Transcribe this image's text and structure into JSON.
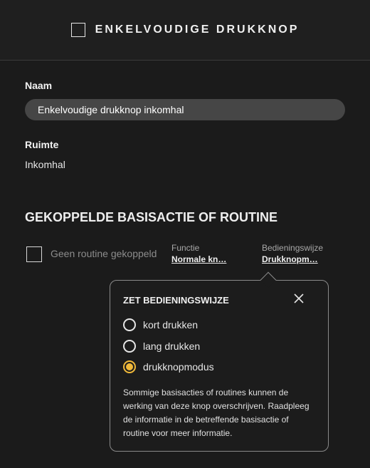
{
  "header": {
    "title": "ENKELVOUDIGE DRUKKNOP",
    "icon": "square-outline-icon"
  },
  "name": {
    "label": "Naam",
    "value": "Enkelvoudige drukknop inkomhal"
  },
  "room": {
    "label": "Ruimte",
    "value": "Inkomhal"
  },
  "linked": {
    "section_title": "GEKOPPELDE BASISACTIE OF ROUTINE",
    "routine_label": "Geen routine gekoppeld",
    "function_label": "Functie",
    "function_value": "Normale kn…",
    "mode_label": "Bedieningswijze",
    "mode_value": "Drukknopm…"
  },
  "popover": {
    "title": "ZET BEDIENINGSWIJZE",
    "options": [
      {
        "label": "kort drukken",
        "selected": false
      },
      {
        "label": "lang drukken",
        "selected": false
      },
      {
        "label": "drukknopmodus",
        "selected": true
      }
    ],
    "info": "Sommige basisacties of routines kunnen de werking van deze knop overschrijven. Raadpleeg de informatie in de betreffende basisactie of routine voor meer informatie."
  },
  "colors": {
    "accent": "#f0b93a",
    "background": "#1b1b1b",
    "input": "#464646"
  }
}
